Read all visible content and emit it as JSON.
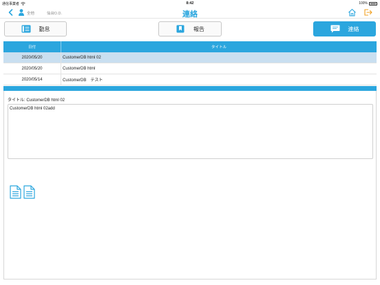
{
  "status_bar": {
    "carrier": "通信事業者",
    "time": "8:42",
    "battery": "100%"
  },
  "nav": {
    "title": "連絡",
    "user_name": "全他",
    "branch": "仙台D.D."
  },
  "segments": [
    {
      "label": "勤怠",
      "icon": "list-book-icon",
      "active": false
    },
    {
      "label": "報告",
      "icon": "bookmark-icon",
      "active": false
    },
    {
      "label": "連絡",
      "icon": "message-icon",
      "active": true
    }
  ],
  "table": {
    "headers": {
      "date": "日付",
      "title": "タイトル"
    },
    "rows": [
      {
        "date": "2020/05/20",
        "title": "CustomerDB html 02",
        "selected": true
      },
      {
        "date": "2020/05/20",
        "title": "CustomerDB html",
        "selected": false
      },
      {
        "date": "2020/05/14",
        "title": "CustomerDB　テスト",
        "selected": false
      }
    ]
  },
  "detail": {
    "title_label": "タイトル: CustomerDB html 02",
    "body": "CustomerDB html 02add"
  },
  "colors": {
    "accent": "#2ba6de",
    "selected_row": "#c9dff0"
  }
}
